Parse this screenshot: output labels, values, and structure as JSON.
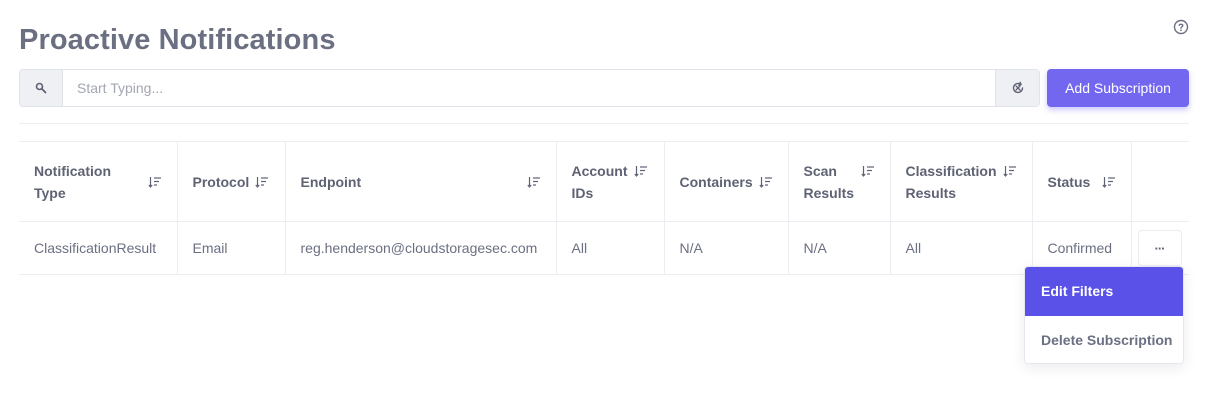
{
  "page": {
    "title": "Proactive Notifications"
  },
  "icons": {
    "help": "help-circle-icon",
    "search": "search-icon",
    "clear": "refresh-icon",
    "sort": "sort-icon",
    "more": "more-horizontal-icon"
  },
  "search": {
    "placeholder": "Start Typing...",
    "value": ""
  },
  "toolbar": {
    "add_label": "Add Subscription"
  },
  "colors": {
    "primary": "#7367f0",
    "primary_active": "#5a52e8",
    "text": "#6b6f82",
    "border": "#ebedf2"
  },
  "table": {
    "columns": [
      {
        "label": "Notification\nType"
      },
      {
        "label": "Protocol"
      },
      {
        "label": "Endpoint"
      },
      {
        "label": "Account\nIDs"
      },
      {
        "label": "Containers"
      },
      {
        "label": "Scan\nResults"
      },
      {
        "label": "Classification\nResults"
      },
      {
        "label": "Status"
      }
    ],
    "rows": [
      {
        "notification_type": "ClassificationResult",
        "protocol": "Email",
        "endpoint": "reg.henderson@cloudstoragesec.com",
        "account_ids": "All",
        "containers": "N/A",
        "scan_results": "N/A",
        "classification_results": "All",
        "status": "Confirmed",
        "actions_label": "···"
      }
    ]
  },
  "dropdown": {
    "items": [
      {
        "label": "Edit Filters",
        "active": true
      },
      {
        "label": "Delete Subscription",
        "active": false
      }
    ]
  }
}
